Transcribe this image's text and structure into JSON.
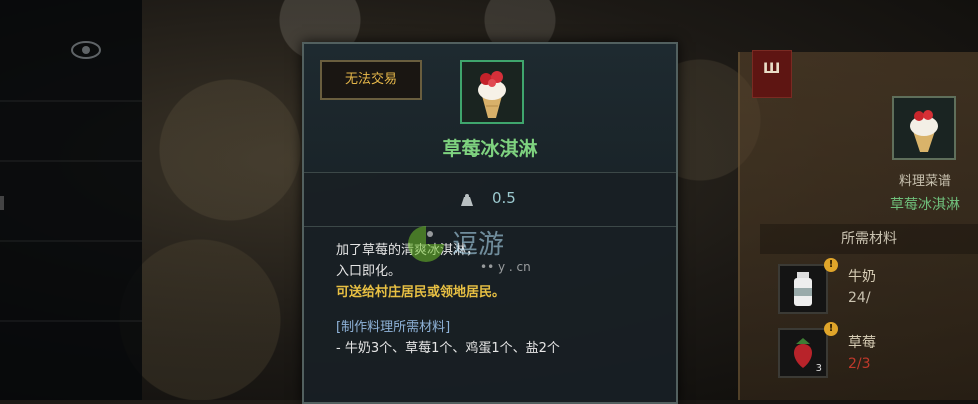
{
  "tooltip": {
    "trade_badge": "无法交易",
    "item_icon": "strawberry-ice-cream-icon",
    "item_name": "草莓冰淇淋",
    "weight_icon": "weight-icon",
    "weight": "0.5",
    "description_line1": "加了草莓的清爽冰淇淋，",
    "description_line2": "入口即化。",
    "gift_note": "可送给村庄居民或领地居民。",
    "materials_header": "[制作料理所需材料]",
    "materials_list": "- 牛奶3个、草莓1个、鸡蛋1个、盐2个"
  },
  "recipe_panel": {
    "flag_icon": "recipe-book-icon",
    "flag_text": "Ш",
    "caption": "料理菜谱",
    "dish_name": "草莓冰淇淋",
    "materials_header": "所需材料",
    "materials": [
      {
        "name": "牛奶",
        "count": "24/",
        "icon": "milk-bottle-icon",
        "alert": "!"
      },
      {
        "name": "草莓",
        "count": "2/3",
        "icon": "strawberry-icon",
        "alert": "!",
        "slot_count": "3"
      }
    ]
  },
  "watermark": {
    "text": "逗游",
    "subtext": "•• y . cn"
  },
  "colors": {
    "item_name": "#7ed27f",
    "trade_badge_text": "#e7b84a",
    "gift_note": "#e8c043",
    "materials_header": "#8fb3d9",
    "weight_value": "#9bc9cf",
    "count_deficit": "#c0392b"
  }
}
